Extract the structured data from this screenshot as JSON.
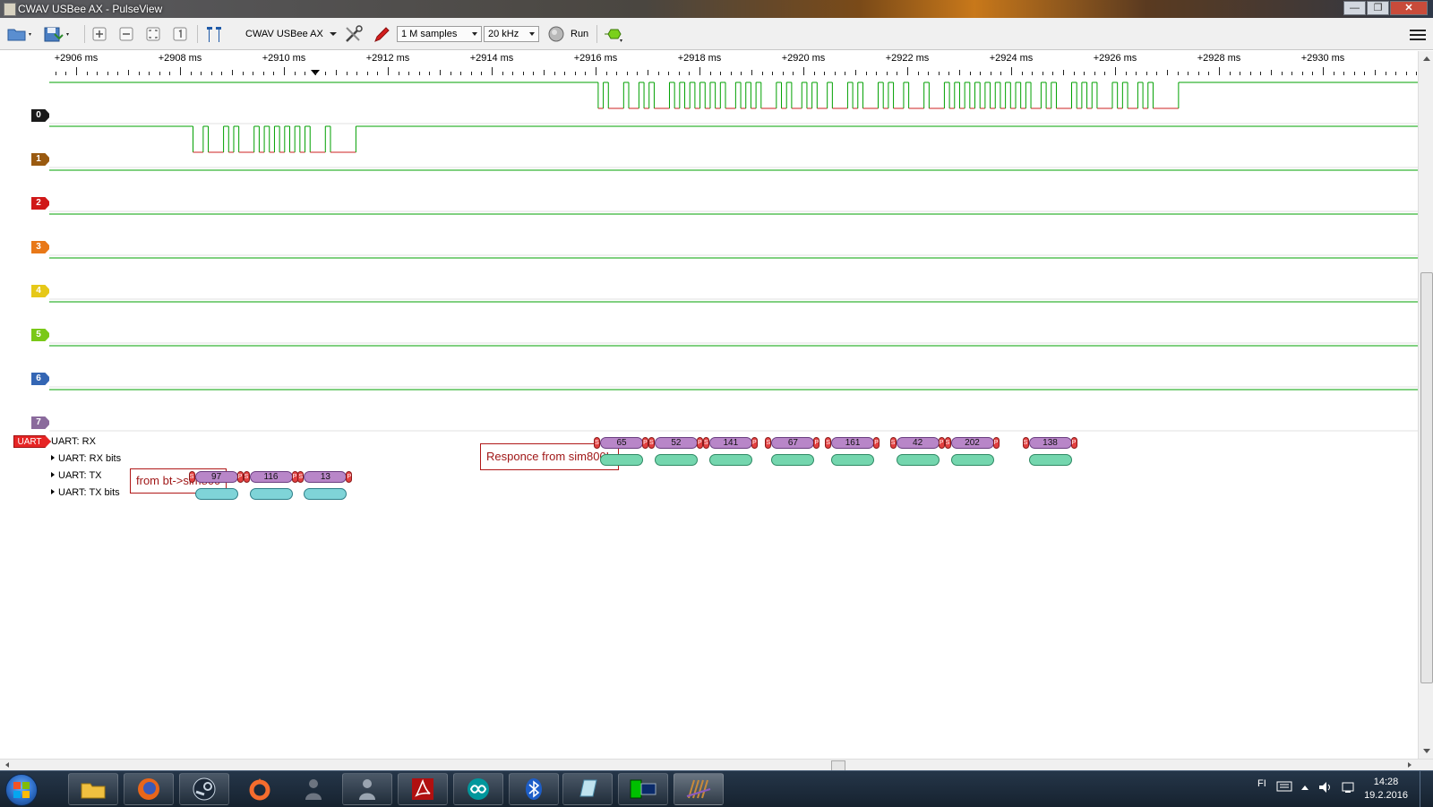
{
  "window": {
    "title": "CWAV USBee AX - PulseView"
  },
  "toolbar": {
    "device": "CWAV USBee AX",
    "samples": "1 M samples",
    "samplerate": "20 kHz",
    "run_label": "Run"
  },
  "ruler": {
    "ticks": [
      "+2906 ms",
      "+2908 ms",
      "+2910 ms",
      "+2912 ms",
      "+2914 ms",
      "+2916 ms",
      "+2918 ms",
      "+2920 ms",
      "+2922 ms",
      "+2924 ms",
      "+2926 ms",
      "+2928 ms",
      "+2930 ms"
    ]
  },
  "channels": [
    {
      "label": "0",
      "color": "#1a1a1a"
    },
    {
      "label": "1",
      "color": "#9a5a10"
    },
    {
      "label": "2",
      "color": "#d01818"
    },
    {
      "label": "3",
      "color": "#e87818"
    },
    {
      "label": "4",
      "color": "#e6c818"
    },
    {
      "label": "5",
      "color": "#7ac818"
    },
    {
      "label": "6",
      "color": "#3466b4"
    },
    {
      "label": "7",
      "color": "#8a6a9c"
    }
  ],
  "decoder": {
    "tag": "UART",
    "rows": [
      "UART: RX",
      "UART: RX bits",
      "UART: TX",
      "UART: TX bits"
    ],
    "rx_values": [
      "65",
      "52",
      "141",
      "67",
      "161",
      "42",
      "202",
      "138"
    ],
    "tx_values": [
      "97",
      "116",
      "13"
    ],
    "rx_bits": [
      "",
      "",
      "",
      "",
      "",
      "",
      "",
      ""
    ],
    "tx_bits": [
      "",
      "",
      ""
    ],
    "marker_s": "S",
    "marker_p": "P"
  },
  "annotations": {
    "tx_note": "from bt->sim800",
    "rx_note": "Responce from sim800L"
  },
  "colors": {
    "trace_green": "#00a000",
    "trace_red": "#cc2020"
  },
  "clock": {
    "time": "14:28",
    "date": "19.2.2016"
  },
  "tray": {
    "lang": "FI"
  }
}
